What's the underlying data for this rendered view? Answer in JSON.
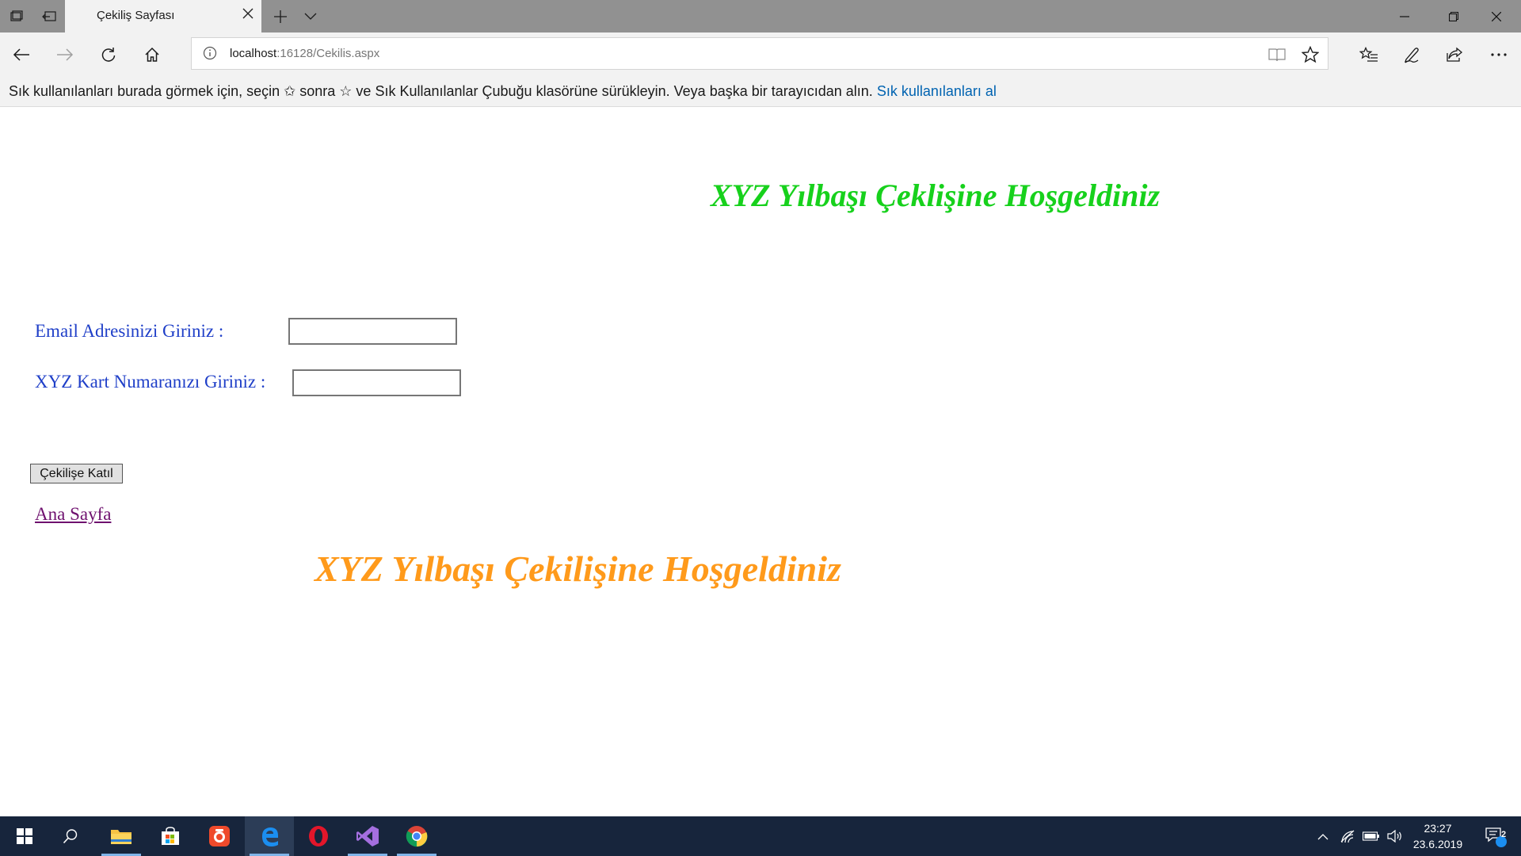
{
  "browser": {
    "tab_title": "Çekiliş Sayfası",
    "address": {
      "host": "localhost",
      "rest": ":16128/Cekilis.aspx"
    },
    "favorites_bar": {
      "text_before": "Sık kullanılanları burada görmek için, seçin ",
      "star_glyph_1": "✩",
      "text_mid": " sonra ☆ ve Sık Kullanılanlar Çubuğu klasörüne sürükleyin. Veya başka bir tarayıcıdan alın. ",
      "link": "Sık kullanılanları al"
    }
  },
  "page": {
    "heading_top": "XYZ Yılbaşı Çeklişine Hoşgeldiniz",
    "email_label": "Email Adresinizi Giriniz :",
    "email_value": "",
    "card_label": "XYZ Kart Numaranızı Giriniz :",
    "card_value": "",
    "submit_label": "Çekilişe Katıl",
    "home_link": "Ana Sayfa",
    "heading_bottom": "XYZ Yılbaşı Çekilişine Hoşgeldiniz"
  },
  "taskbar": {
    "time": "23:27",
    "date": "23.6.2019",
    "notification_count": "2"
  },
  "colors": {
    "heading_top": "#17d11c",
    "heading_bottom": "#ff9a1b",
    "label": "#1f3fc8",
    "link_visited": "#6f116f",
    "favbar_link": "#0063b1"
  }
}
